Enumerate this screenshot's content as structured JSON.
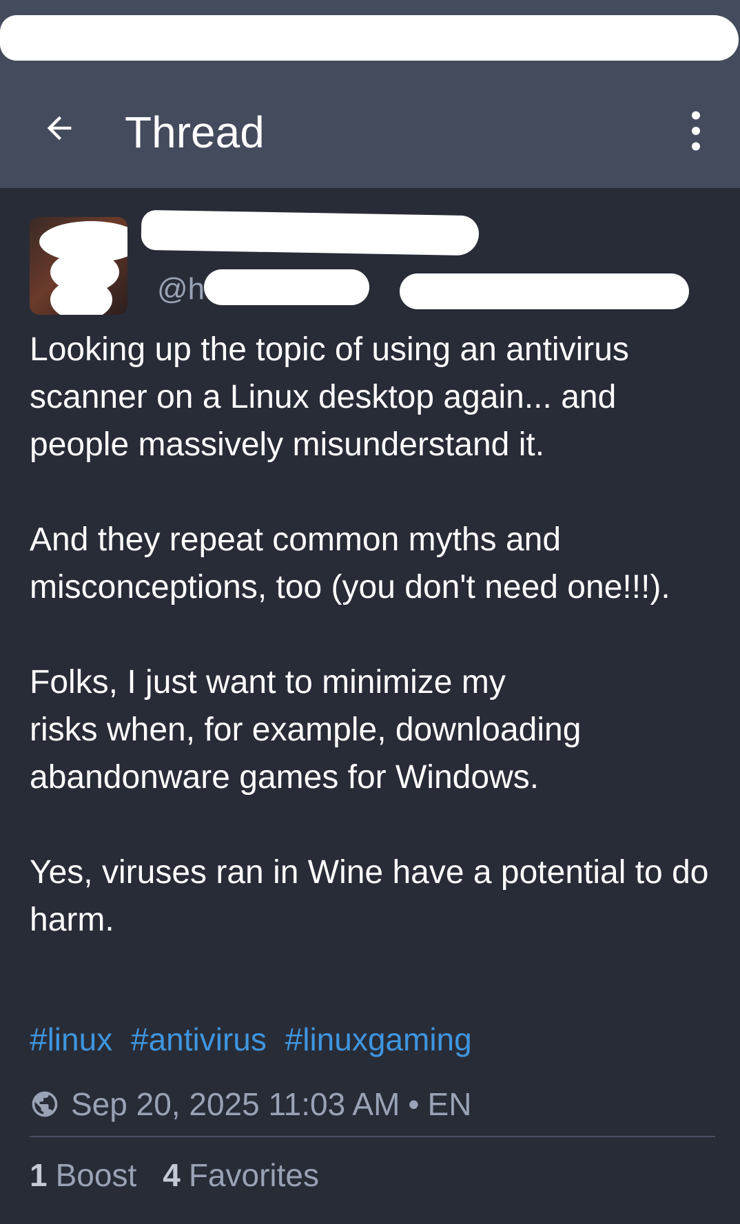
{
  "app_bar": {
    "title": "Thread",
    "back_icon": "arrow-left-icon",
    "menu_icon": "more-vertical-icon"
  },
  "post": {
    "display_name": "",
    "handle": "@h",
    "paragraphs": [
      "Looking up the topic of using an antivirus scanner on a Linux desktop again... and people massively misunderstand it.",
      "And they repeat common myths and misconceptions, too (you don't need one!!!).",
      "Folks, I just want to minimize my\nrisks when, for example, downloading abandonware games for Windows.",
      "Yes, viruses ran in Wine have a potential to do harm."
    ],
    "hashtags": [
      "#linux",
      "#antivirus",
      "#linuxgaming"
    ],
    "meta": {
      "visibility_icon": "globe-icon",
      "timestamp": "Sep 20, 2025 11:03 AM",
      "separator": "•",
      "language": "EN"
    },
    "stats": {
      "boosts_count": "1",
      "boosts_label": "Boost",
      "favorites_count": "4",
      "favorites_label": "Favorites"
    }
  },
  "colors": {
    "background": "#282c37",
    "app_bar": "#444b5d",
    "link": "#3f96e0",
    "muted_text": "#9aa3b5",
    "text": "#ffffff"
  }
}
